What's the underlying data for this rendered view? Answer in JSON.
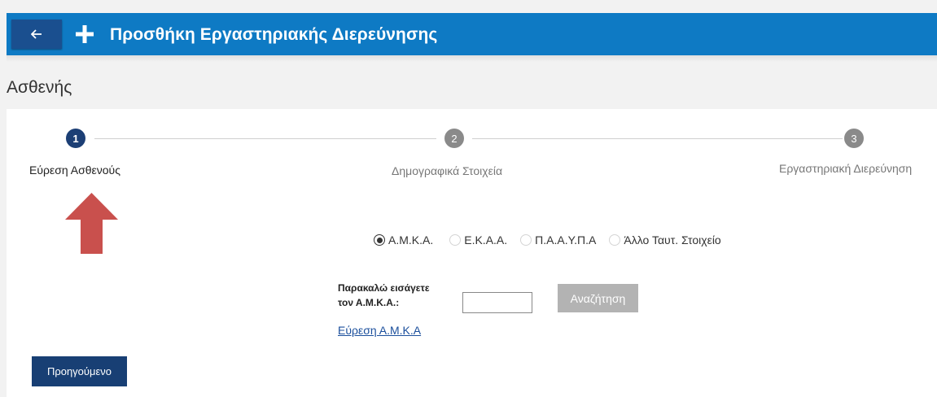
{
  "header": {
    "back_icon": "arrow-left-icon",
    "add_icon": "plus-icon",
    "title": "Προσθήκη Εργαστηριακής Διερεύνησης"
  },
  "section_title": "Ασθενής",
  "steps": [
    {
      "number": "1",
      "label": "Εύρεση Ασθενούς",
      "active": true
    },
    {
      "number": "2",
      "label": "Δημογραφικά Στοιχεία",
      "active": false
    },
    {
      "number": "3",
      "label": "Εργαστηριακή Διερεύνηση",
      "active": false
    }
  ],
  "annotation_arrow": {
    "icon": "arrow-up-icon",
    "color": "#c9504d"
  },
  "id_type": {
    "options": [
      "Α.Μ.Κ.Α.",
      "Ε.Κ.Α.Α.",
      "Π.Α.Α.Υ.Π.Α",
      "Άλλο Ταυτ. Στοιχείο"
    ],
    "selected": "Α.Μ.Κ.Α."
  },
  "search": {
    "prompt_line1": "Παρακαλώ εισάγετε",
    "prompt_line2": "τον Α.Μ.Κ.Α.:",
    "input_value": "",
    "button_label": "Αναζήτηση",
    "find_link": "Εύρεση Α.Μ.Κ.Α"
  },
  "footer": {
    "previous_label": "Προηγούμενο"
  },
  "colors": {
    "header_bg": "#0e7ac4",
    "back_button_bg": "#1a4f8f",
    "active_step": "#1c3f75",
    "inactive_step": "#8a8a8a",
    "primary_button": "#183f74",
    "disabled_button": "#b3b3b3",
    "link": "#1b4f9c"
  }
}
